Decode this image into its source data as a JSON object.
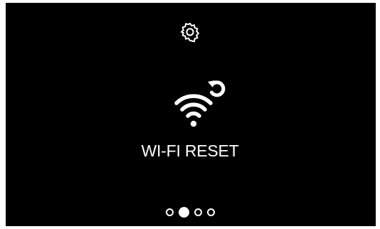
{
  "screen": {
    "background": "#000000",
    "foreground": "#ffffff",
    "settings_icon": "gear-icon",
    "main_icon": "wifi-reset-icon",
    "title": "WI-FI RESET"
  },
  "pager": {
    "total": 4,
    "active_index": 1
  }
}
